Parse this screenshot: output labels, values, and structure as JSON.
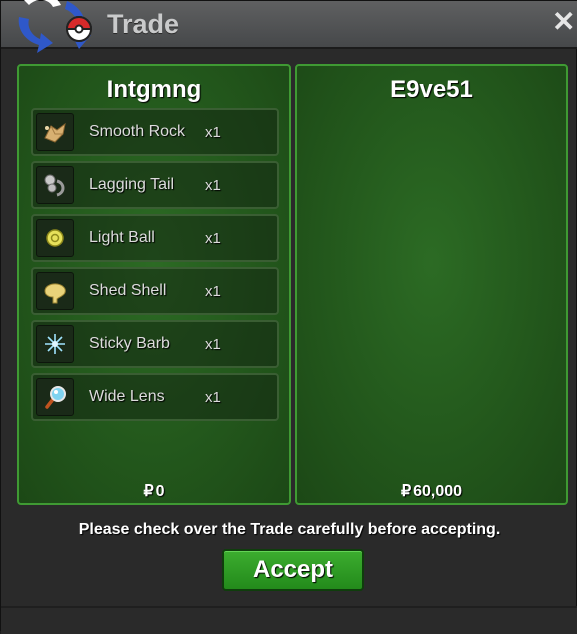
{
  "window": {
    "title": "Trade",
    "close_symbol": "✕"
  },
  "left_trader": {
    "name": "Intgmng",
    "money_symbol": "₽",
    "money": "0",
    "items": [
      {
        "name": "Smooth Rock",
        "qty": "x1",
        "icon": "smooth-rock-icon"
      },
      {
        "name": "Lagging Tail",
        "qty": "x1",
        "icon": "lagging-tail-icon"
      },
      {
        "name": "Light Ball",
        "qty": "x1",
        "icon": "light-ball-icon"
      },
      {
        "name": "Shed Shell",
        "qty": "x1",
        "icon": "shed-shell-icon"
      },
      {
        "name": "Sticky Barb",
        "qty": "x1",
        "icon": "sticky-barb-icon"
      },
      {
        "name": "Wide Lens",
        "qty": "x1",
        "icon": "wide-lens-icon"
      }
    ]
  },
  "right_trader": {
    "name": "E9ve51",
    "money_symbol": "₽",
    "money": "60,000",
    "items": []
  },
  "notice": "Please check over the Trade carefully before accepting.",
  "accept_label": "Accept",
  "colors": {
    "panel_green": "#23581c",
    "panel_border": "#3f9a33",
    "button_green": "#2f9d24"
  }
}
